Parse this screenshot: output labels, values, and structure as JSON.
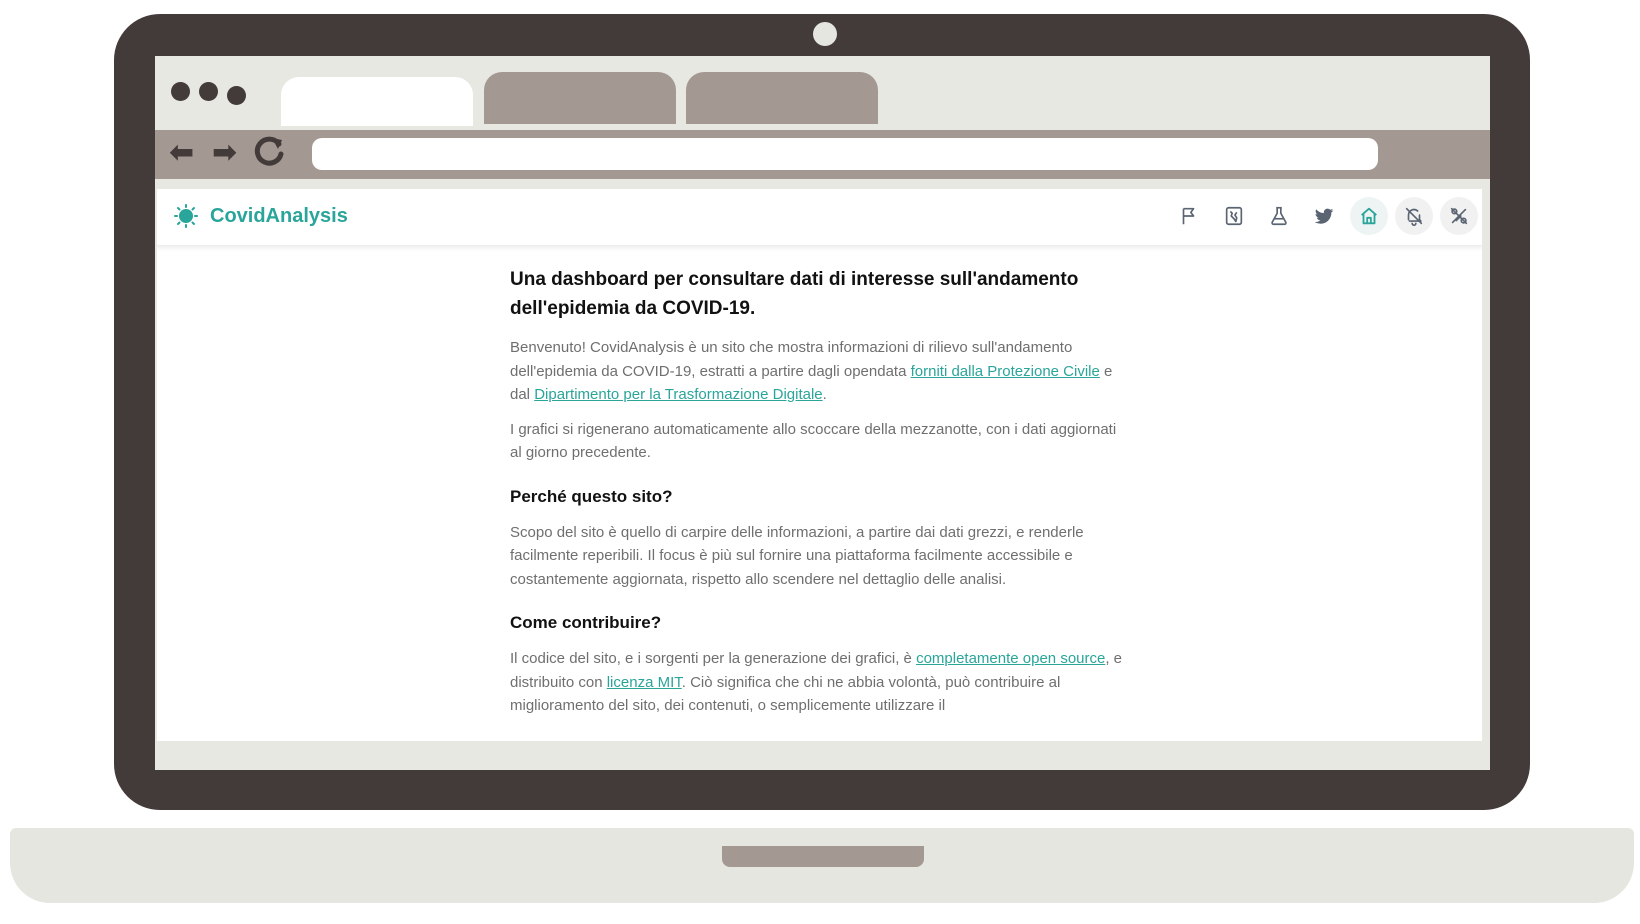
{
  "app": {
    "brand_name": "CovidAnalysis",
    "brand_icon": "virus-icon",
    "accent_color": "#2aa59a"
  },
  "browser": {
    "nav": {
      "back_icon": "arrow-left-icon",
      "forward_icon": "arrow-right-icon",
      "reload_icon": "reload-icon"
    },
    "address_value": ""
  },
  "nav_icons": [
    {
      "name": "flag-icon",
      "active": false
    },
    {
      "name": "region-map-icon",
      "active": false
    },
    {
      "name": "flask-icon",
      "active": false
    },
    {
      "name": "twitter-icon",
      "active": false
    },
    {
      "name": "home-icon",
      "active": true
    },
    {
      "name": "notifications-off-icon",
      "active": false
    },
    {
      "name": "percent-icon",
      "active": false
    }
  ],
  "main": {
    "title": "Una dashboard per consultare dati di interesse sull'andamento dell'epidemia da COVID-19.",
    "intro": {
      "text1": "Benvenuto! CovidAnalysis è un sito che mostra informazioni di rilievo sull'andamento dell'epidemia da COVID-19, estratti a partire dagli opendata ",
      "link1": "forniti dalla Protezione Civile",
      "text2": " e dal ",
      "link2": "Dipartimento per la Trasformazione Digitale",
      "text3": "."
    },
    "refresh_text": "I grafici si rigenerano automaticamente allo scoccare della mezzanotte, con i dati aggiornati al giorno precedente.",
    "why_heading": "Perché questo sito?",
    "why_text": "Scopo del sito è quello di carpire delle informazioni, a partire dai dati grezzi, e renderle facilmente reperibili. Il focus è più sul fornire una piattaforma facilmente accessibile e costantemente aggiornata, rispetto allo scendere nel dettaglio delle analisi.",
    "contrib_heading": "Come contribuire?",
    "contrib": {
      "text1": "Il codice del sito, e i sorgenti per la generazione dei grafici, è ",
      "link1": "completamente open source",
      "text2": ", e distribuito con ",
      "link2": "licenza MIT",
      "text3": ". Ciò significa che chi ne abbia volontà, può contribuire al miglioramento del sito, dei contenuti, o semplicemente utilizzare il"
    }
  }
}
